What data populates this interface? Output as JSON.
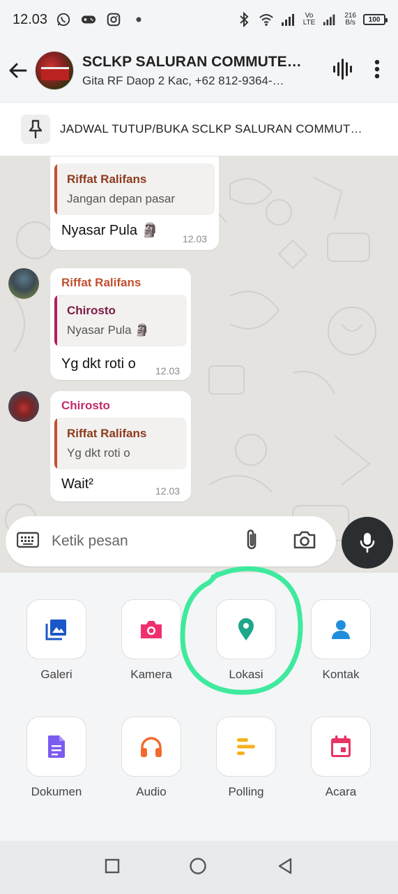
{
  "status_bar": {
    "time": "12.03",
    "net_speed": "216",
    "net_unit": "B/s",
    "volte": "Vo",
    "lte": "LTE",
    "battery": "100",
    "icons": [
      "whatsapp-icon",
      "gamepad-icon",
      "instagram-icon",
      "dot-icon",
      "bluetooth-icon",
      "wifi-icon",
      "signal-icon",
      "battery-icon"
    ]
  },
  "header": {
    "title": "SCLKP SALURAN COMMUTE…",
    "subtitle": "Gita RF Daop 2 Kac, +62 812-9364-…"
  },
  "pinned": {
    "text": "JADWAL TUTUP/BUKA SCLKP SALURAN COMMUT…"
  },
  "messages": [
    {
      "sender": "",
      "quote_name": "Riffat Ralifans",
      "quote_text": "Jangan depan pasar",
      "text": "Nyasar Pula 🗿",
      "time": "12.03"
    },
    {
      "sender": "Riffat Ralifans",
      "quote_name": "Chirosto",
      "quote_text": "Nyasar Pula 🗿",
      "text": "Yg dkt roti o",
      "time": "12.03"
    },
    {
      "sender": "Chirosto",
      "quote_name": "Riffat Ralifans",
      "quote_text": "Yg dkt roti o",
      "text": "Wait²",
      "time": "12.03"
    }
  ],
  "input": {
    "placeholder": "Ketik pesan"
  },
  "attachments": [
    {
      "label": "Galeri",
      "icon": "gallery-icon",
      "color": "#1c57c9"
    },
    {
      "label": "Kamera",
      "icon": "camera-icon",
      "color": "#f0306e"
    },
    {
      "label": "Lokasi",
      "icon": "location-pin-icon",
      "color": "#1ea78a"
    },
    {
      "label": "Kontak",
      "icon": "contact-icon",
      "color": "#1f8fdc"
    },
    {
      "label": "Dokumen",
      "icon": "document-icon",
      "color": "#7b5cf0"
    },
    {
      "label": "Audio",
      "icon": "headphones-icon",
      "color": "#f26a2d"
    },
    {
      "label": "Polling",
      "icon": "poll-icon",
      "color": "#f5b11c"
    },
    {
      "label": "Acara",
      "icon": "calendar-icon",
      "color": "#e83464"
    }
  ],
  "colors": {
    "sender_riffat": "#c0502e",
    "sender_chirosto": "#c22a6a",
    "quote_bar_riffat": "#c0502e",
    "quote_bar_chirosto": "#b31e5b",
    "quote_name_riffat": "#8d3b1e",
    "quote_name_chirosto": "#7a1c45",
    "highlight": "#3fea9e"
  }
}
